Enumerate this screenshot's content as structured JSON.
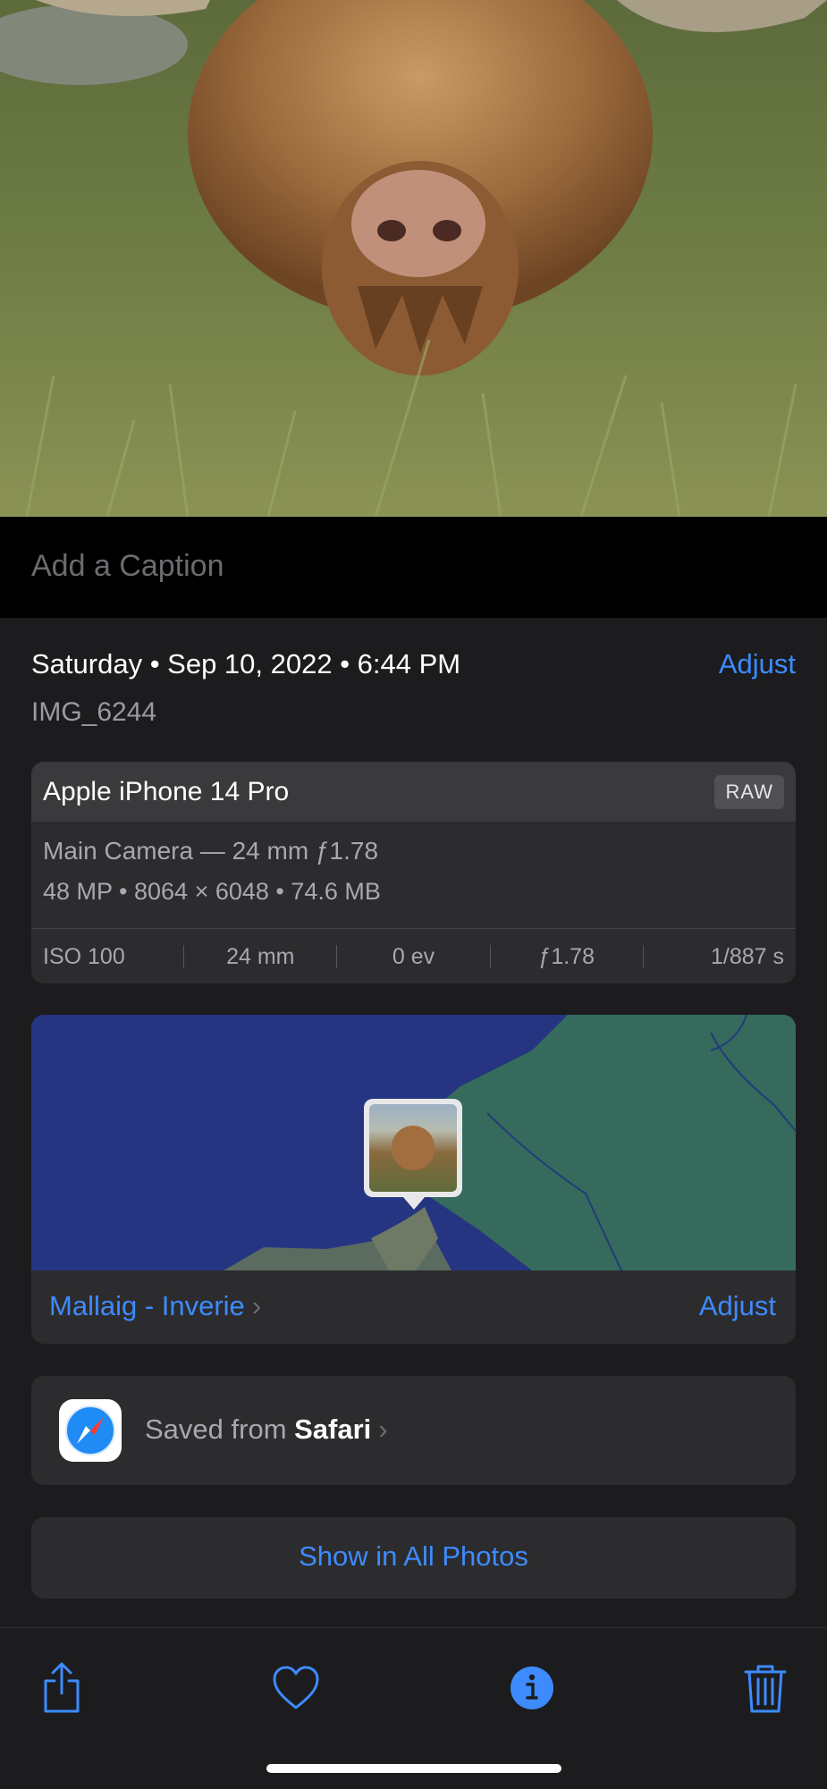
{
  "caption": {
    "placeholder": "Add a Caption"
  },
  "info": {
    "date": "Saturday • Sep 10, 2022 • 6:44 PM",
    "adjust_label": "Adjust",
    "filename": "IMG_6244"
  },
  "camera": {
    "model": "Apple iPhone 14 Pro",
    "format_badge": "RAW",
    "lens": "Main Camera — 24 mm ƒ1.78",
    "specs": "48 MP  •  8064 × 6048  •  74.6 MB",
    "exif": {
      "iso": "ISO 100",
      "focal": "24 mm",
      "ev": "0 ev",
      "aperture": "ƒ1.78",
      "shutter": "1/887 s"
    }
  },
  "location": {
    "place": "Mallaig - Inverie",
    "adjust_label": "Adjust"
  },
  "source": {
    "prefix": "Saved from ",
    "app": "Safari"
  },
  "show_all_label": "Show in All Photos",
  "colors": {
    "accent": "#3d8bff",
    "background": "#1c1c1e",
    "card": "#2c2c2e"
  },
  "toolbar_icons": [
    "share-icon",
    "heart-icon",
    "info-icon",
    "trash-icon"
  ]
}
